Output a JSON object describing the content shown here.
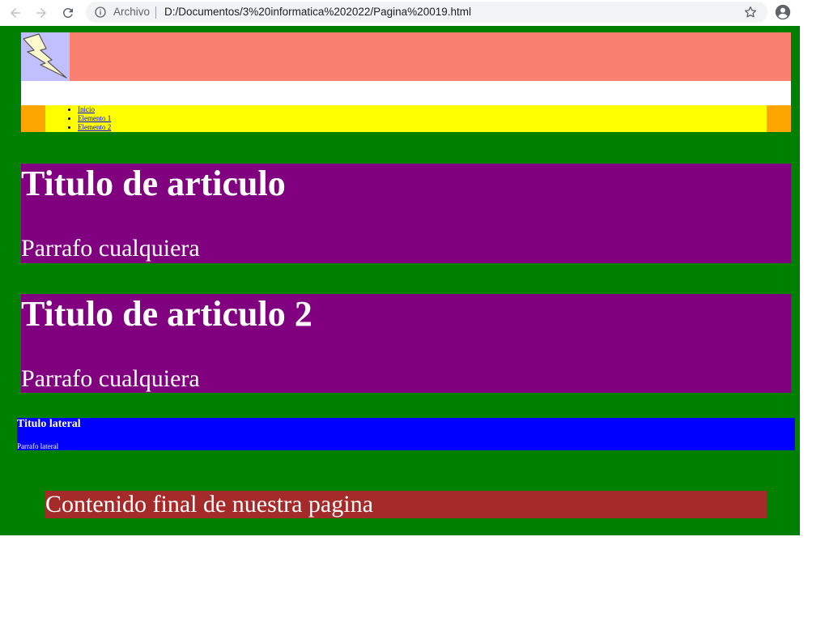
{
  "browser": {
    "security_label": "Archivo",
    "url": "D:/Documentos/3%20informatica%202022/Pagina%20019.html",
    "icons": {
      "back": "arrow-left-icon",
      "forward": "arrow-right-icon",
      "reload": "reload-icon",
      "info": "info-icon",
      "bookmark": "star-icon",
      "profile": "account-circle-icon"
    }
  },
  "page": {
    "colors": {
      "background": "#008000",
      "header": "#fa8072",
      "logo_bg": "#c0c0ff",
      "nav_outer": "#ffa500",
      "nav_inner": "#ffff00",
      "article": "#800080",
      "aside": "#0000ff",
      "footer": "#a52a2a"
    },
    "header": {
      "logo_icon": "lightning-bolt-icon"
    },
    "nav": {
      "items": [
        {
          "label": "Inicio"
        },
        {
          "label": "Elemento 1"
        },
        {
          "label": "Elemento 2"
        }
      ]
    },
    "articles": [
      {
        "title": "Titulo de articulo",
        "paragraph": "Parrafo cualquiera"
      },
      {
        "title": "Titulo de articulo 2",
        "paragraph": "Parrafo cualquiera"
      }
    ],
    "aside": {
      "title": "Titulo lateral",
      "paragraph": "Parrafo lateral"
    },
    "footer": {
      "text": "Contenido final de nuestra pagina"
    }
  }
}
